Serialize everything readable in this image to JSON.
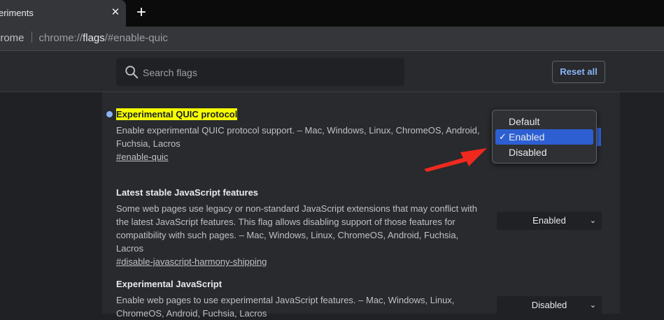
{
  "tab": {
    "title": "eriments",
    "close_icon": "close-icon",
    "new_tab_icon": "plus-icon"
  },
  "omnibox": {
    "site_label": "hrome",
    "scheme": "chrome://",
    "host": "flags",
    "path": "/#enable-quic"
  },
  "search": {
    "placeholder": "Search flags",
    "value": "",
    "icon": "search-icon"
  },
  "reset_label": "Reset all",
  "flags": [
    {
      "title": "Experimental QUIC protocol",
      "description": "Enable experimental QUIC protocol support. – Mac, Windows, Linux, ChromeOS, Android, Fuchsia, Lacros",
      "link": "#enable-quic"
    },
    {
      "title": "Latest stable JavaScript features",
      "description": "Some web pages use legacy or non-standard JavaScript extensions that may conflict with the latest JavaScript features. This flag allows disabling support of those features for compatibility with such pages. – Mac, Windows, Linux, ChromeOS, Android, Fuchsia, Lacros",
      "link": "#disable-javascript-harmony-shipping",
      "value": "Enabled"
    },
    {
      "title": "Experimental JavaScript",
      "description": "Enable web pages to use experimental JavaScript features. – Mac, Windows, Linux, ChromeOS, Android, Fuchsia, Lacros",
      "value": "Disabled"
    }
  ],
  "dropdown": {
    "options": [
      "Default",
      "Enabled",
      "Disabled"
    ],
    "selected": "Enabled",
    "check": "✓"
  },
  "colors": {
    "highlight": "#f5ff00",
    "accent": "#8ab4f8",
    "selection": "#2d5fd3",
    "annotation_arrow": "#f0291f"
  }
}
